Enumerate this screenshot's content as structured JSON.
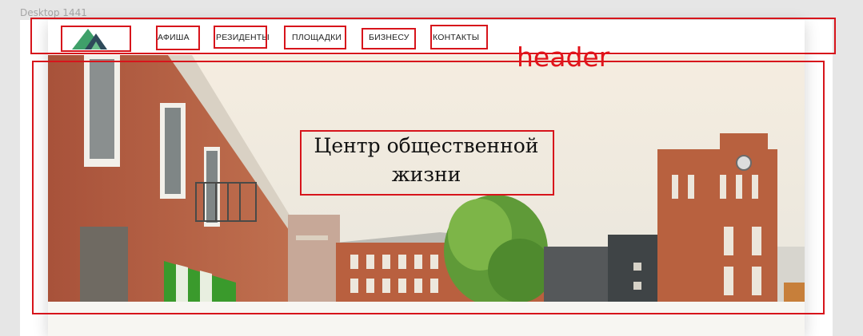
{
  "canvas": {
    "frame_label": "Desktop 1441"
  },
  "nav": {
    "items": [
      {
        "label": "АФИША"
      },
      {
        "label": "РЕЗИДЕНТЫ"
      },
      {
        "label": "ПЛОЩАДКИ"
      },
      {
        "label": "БИЗНЕСУ"
      },
      {
        "label": "КОНТАКТЫ"
      }
    ]
  },
  "hero": {
    "title": "Центр общественной жизни"
  },
  "annotations": {
    "header_label": "header"
  },
  "colors": {
    "annotation": "#d7141b",
    "logo_green": "#3fa06a",
    "logo_dark": "#2e4a5a"
  }
}
